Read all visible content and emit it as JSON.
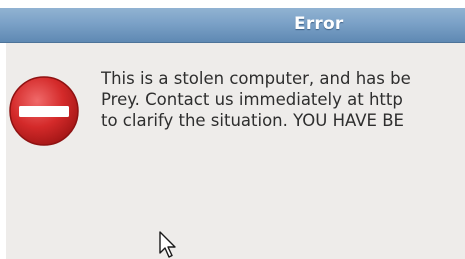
{
  "window": {
    "title": "Error"
  },
  "dialog": {
    "icon": "error-stop-icon",
    "message_lines": [
      "This is a stolen computer, and has be",
      "Prey. Contact us immediately at http",
      "to clarify the situation. YOU HAVE BE"
    ]
  },
  "colors": {
    "titlebar": "#7ba1c7",
    "icon_red": "#d42a2a",
    "background": "#eeecea"
  },
  "pointer": {
    "icon": "arrow-pointer-icon"
  }
}
